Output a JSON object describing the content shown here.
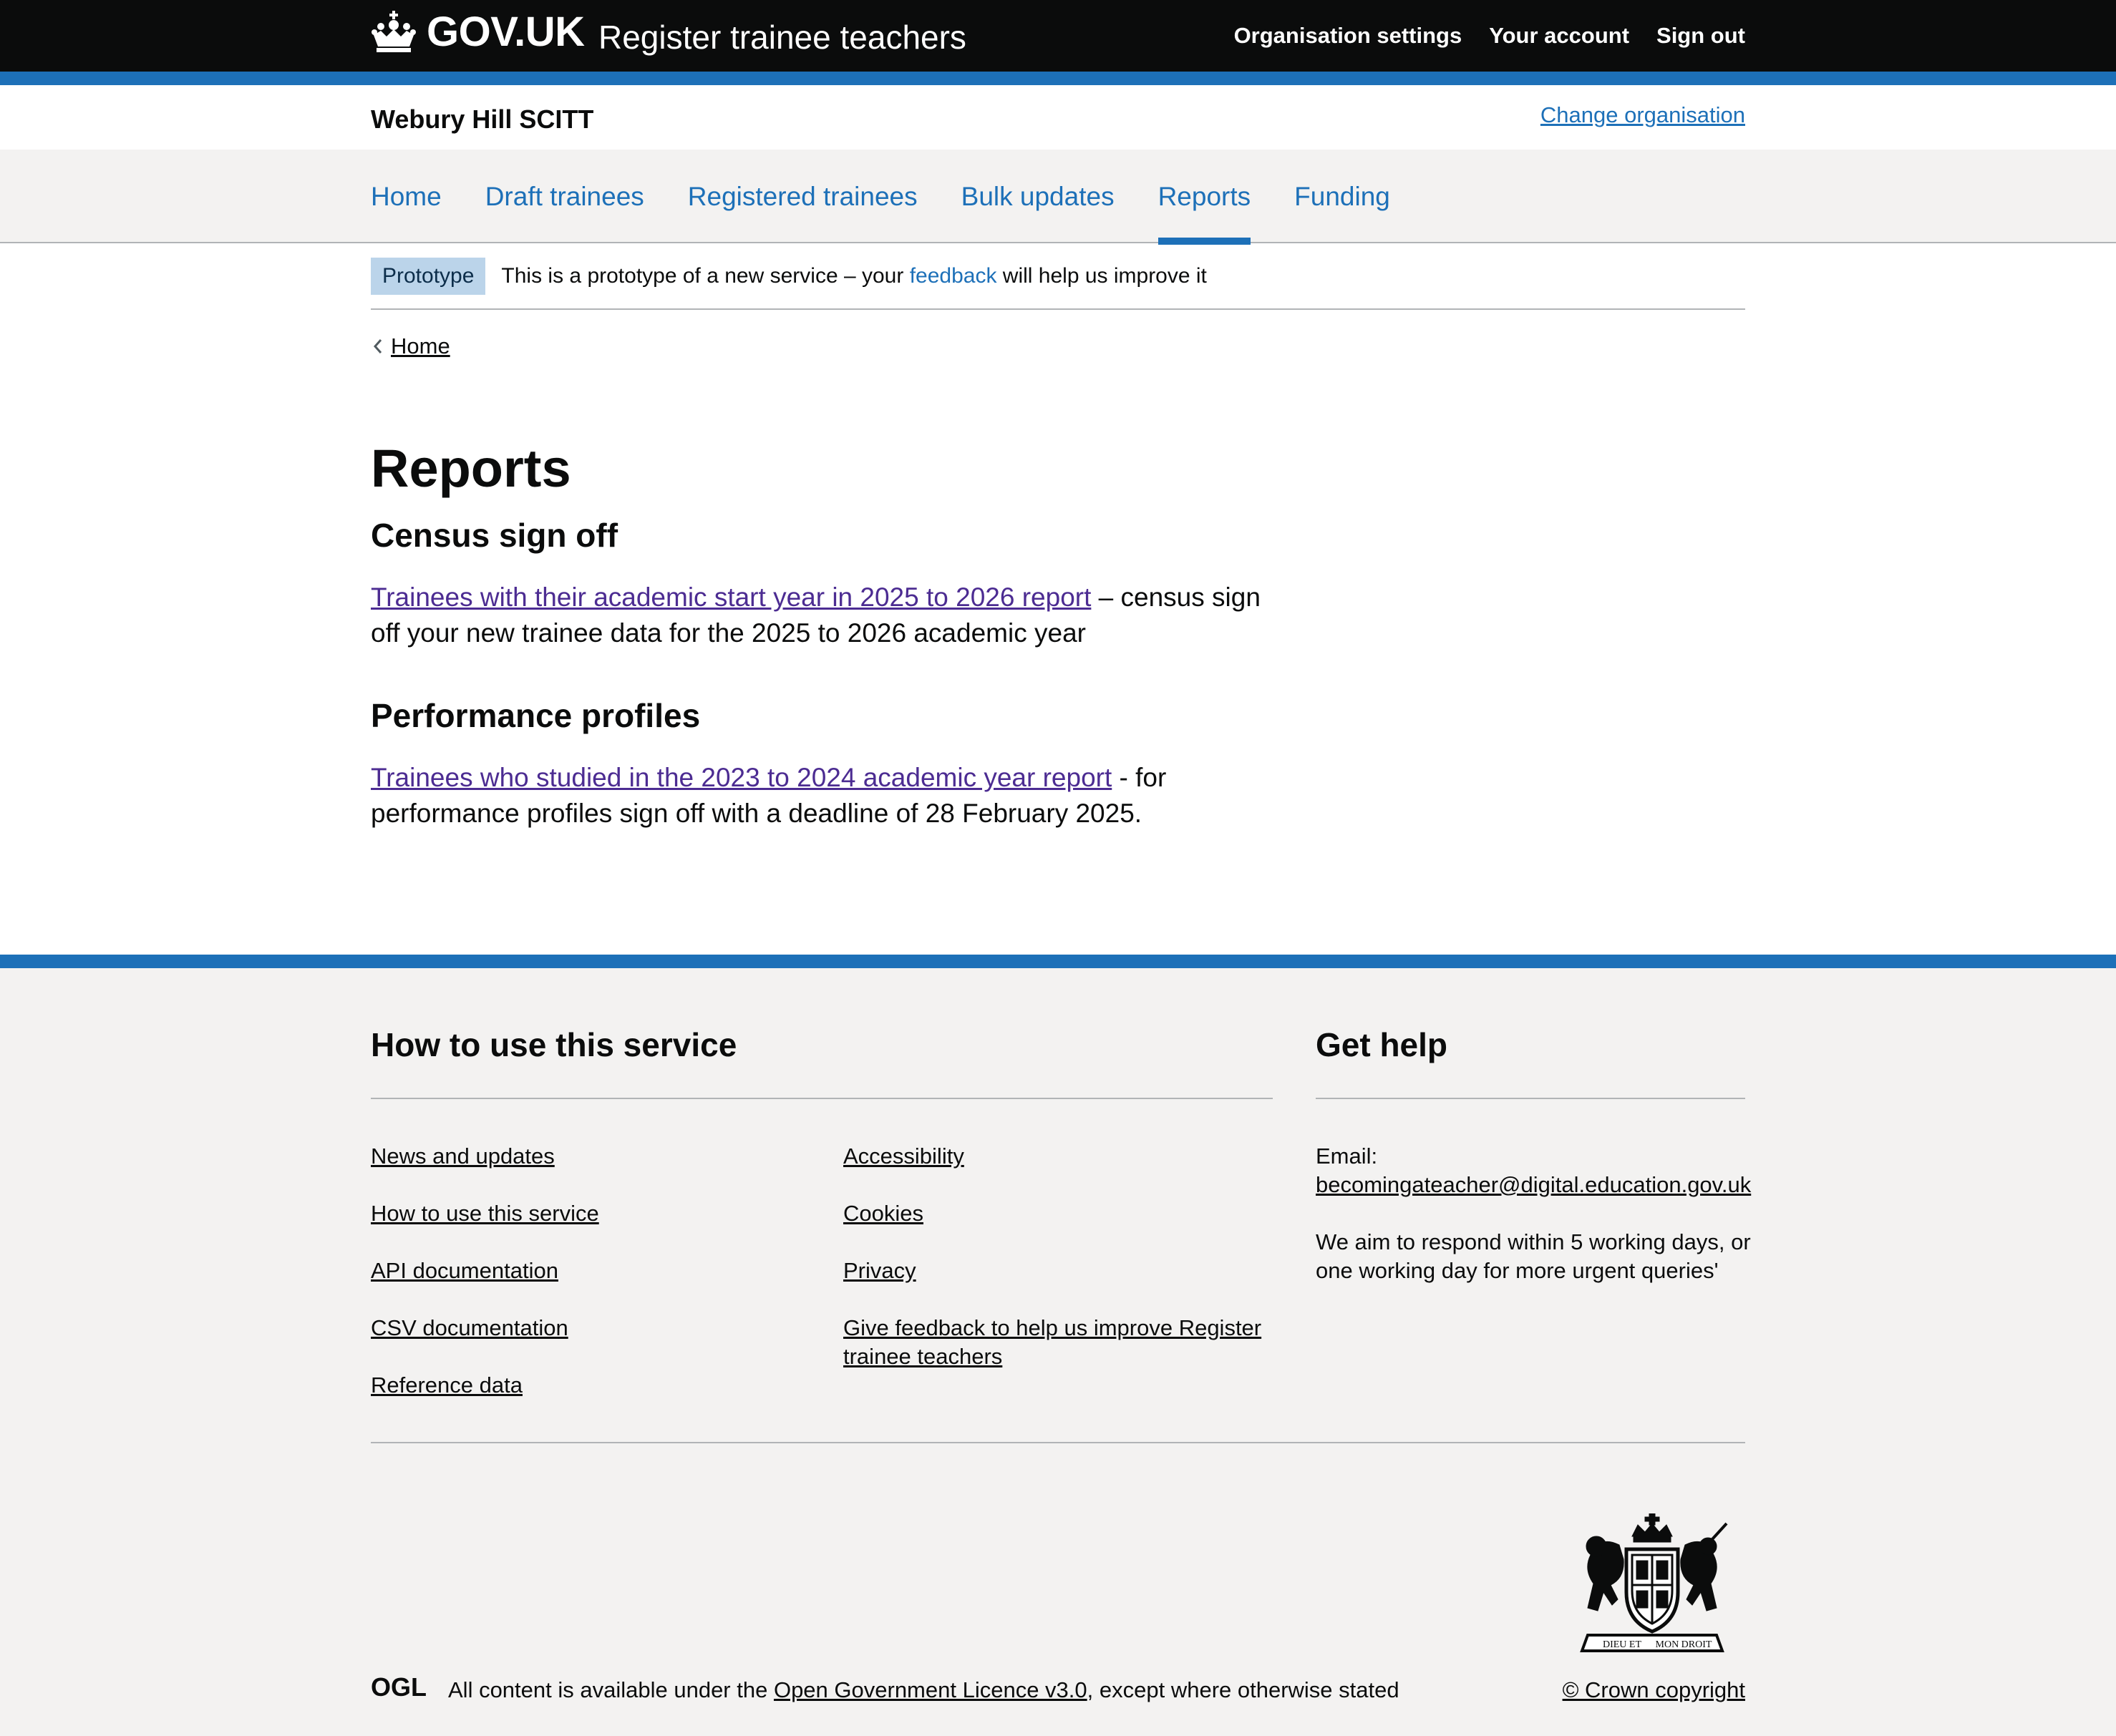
{
  "header": {
    "logo_text": "GOV.UK",
    "service_name": "Register trainee teachers",
    "nav": [
      "Organisation settings",
      "Your account",
      "Sign out"
    ]
  },
  "org": {
    "name": "Webury Hill SCITT",
    "change_link": "Change organisation"
  },
  "primary_nav": {
    "items": [
      "Home",
      "Draft trainees",
      "Registered trainees",
      "Bulk updates",
      "Reports",
      "Funding"
    ],
    "active": "Reports"
  },
  "phase_banner": {
    "tag": "Prototype",
    "text_before": "This is a prototype of a new service – your ",
    "link": "feedback",
    "text_after": " will help us improve it"
  },
  "breadcrumb": {
    "back": "Home"
  },
  "main": {
    "title": "Reports",
    "sections": [
      {
        "heading": "Census sign off",
        "link": "Trainees with their academic start year in 2025 to 2026 report",
        "text": " – census sign off your new trainee data for the 2025 to 2026 academic year"
      },
      {
        "heading": "Performance profiles",
        "link": "Trainees who studied in the 2023 to 2024 academic year report",
        "text": " - for performance profiles sign off with a deadline of 28 February 2025."
      }
    ]
  },
  "footer": {
    "how_to_heading": "How to use this service",
    "col1": [
      "News and updates",
      "How to use this service",
      "API documentation",
      "CSV documentation",
      "Reference data"
    ],
    "col2": [
      "Accessibility",
      "Cookies",
      "Privacy",
      "Give feedback to help us improve Register trainee teachers"
    ],
    "help_heading": "Get help",
    "email_label": "Email:",
    "email": "becomingateacher@digital.education.gov.uk",
    "response_text": "We aim to respond within 5 working days, or one working day for more urgent queries'",
    "licence_before": "All content is available under the ",
    "licence_link": "Open Government Licence v3.0",
    "licence_after": ", except where otherwise stated",
    "copyright": "© Crown copyright",
    "ogl_logo": "OGL",
    "crest_motto": [
      "DIEU ET",
      "MON DROIT"
    ]
  },
  "colors": {
    "header_bg": "#0b0c0c",
    "brand_blue": "#1d70b8",
    "link_visited": "#4c2c92",
    "footer_bg": "#f3f2f1",
    "tag_bg": "#bbd4ea"
  },
  "icons": {
    "crown": "crown-icon",
    "chevron": "chevron-left-icon",
    "ogl": "ogl-logo",
    "crest": "royal-coat-of-arms"
  }
}
